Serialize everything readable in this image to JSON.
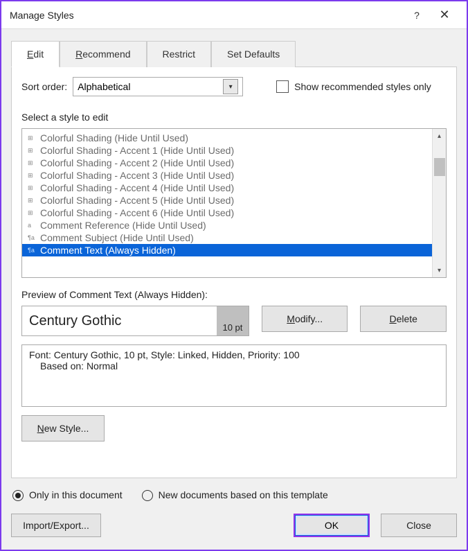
{
  "window": {
    "title": "Manage Styles"
  },
  "tabs": [
    {
      "key": "E",
      "rest": "dit"
    },
    {
      "key": "R",
      "rest": "ecommend"
    },
    {
      "label": "Restrict"
    },
    {
      "label": "Set Defaults"
    }
  ],
  "sort": {
    "label_pre": "S",
    "label_key": "o",
    "label_post": "rt order:",
    "value": "Alphabetical"
  },
  "show_recommended": "Show recommended styles only",
  "select_label": "Select a style to edit",
  "styles": [
    {
      "marker": "⊞",
      "name": "Colorful Shading  (Hide Until Used)"
    },
    {
      "marker": "⊞",
      "name": "Colorful Shading - Accent 1  (Hide Until Used)"
    },
    {
      "marker": "⊞",
      "name": "Colorful Shading - Accent 2  (Hide Until Used)"
    },
    {
      "marker": "⊞",
      "name": "Colorful Shading - Accent 3  (Hide Until Used)"
    },
    {
      "marker": "⊞",
      "name": "Colorful Shading - Accent 4  (Hide Until Used)"
    },
    {
      "marker": "⊞",
      "name": "Colorful Shading - Accent 5  (Hide Until Used)"
    },
    {
      "marker": "⊞",
      "name": "Colorful Shading - Accent 6  (Hide Until Used)"
    },
    {
      "marker": "a",
      "name": "Comment Reference  (Hide Until Used)"
    },
    {
      "marker": "¶a",
      "name": "Comment Subject  (Hide Until Used)"
    },
    {
      "marker": "¶a",
      "name": "Comment Text  (Always Hidden)",
      "selected": true
    }
  ],
  "preview": {
    "label": "Preview of Comment Text  (Always Hidden):",
    "font": "Century Gothic",
    "pt": "10 pt"
  },
  "buttons": {
    "modify_key": "M",
    "modify_rest": "odify...",
    "delete_key": "D",
    "delete_rest": "elete",
    "newstyle_key": "N",
    "newstyle_rest": "ew Style...",
    "import": "Import/Export...",
    "ok": "OK",
    "close": "Close"
  },
  "description": {
    "line1": "Font: Century Gothic, 10 pt, Style: Linked, Hidden, Priority: 100",
    "line2": "Based on: Normal"
  },
  "radios": {
    "only_doc": "Only in this document",
    "new_docs": "New documents based on this template"
  }
}
